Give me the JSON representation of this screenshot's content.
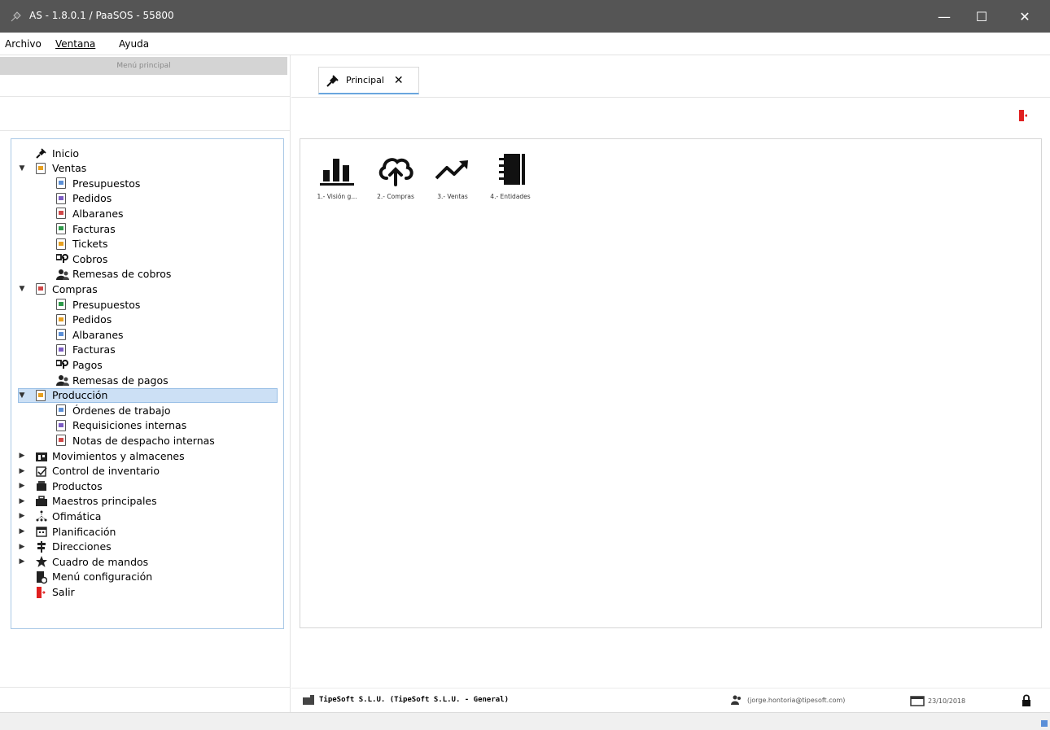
{
  "window": {
    "title": "AS - 1.8.0.1 / PaaSOS - 55800",
    "controls": {
      "minimize": "—",
      "maximize": "☐",
      "close": "✕"
    }
  },
  "menu": [
    "Archivo",
    "Ventana",
    "Ayuda"
  ],
  "left_header": "Menú principal",
  "tree": {
    "selected": "Producción",
    "items": [
      {
        "label": "Inicio",
        "level": 1,
        "expanded": null,
        "icon": "pin-icon"
      },
      {
        "label": "Ventas",
        "level": 1,
        "expanded": true,
        "icon": "document-icon"
      },
      {
        "label": "Presupuestos",
        "level": 2,
        "icon": "document-icon"
      },
      {
        "label": "Pedidos",
        "level": 2,
        "icon": "document-icon"
      },
      {
        "label": "Albaranes",
        "level": 2,
        "icon": "document-icon"
      },
      {
        "label": "Facturas",
        "level": 2,
        "icon": "document-icon"
      },
      {
        "label": "Tickets",
        "level": 2,
        "icon": "document-icon"
      },
      {
        "label": "Cobros",
        "level": 2,
        "icon": "payment-icon"
      },
      {
        "label": "Remesas de cobros",
        "level": 2,
        "icon": "people-icon"
      },
      {
        "label": "Compras",
        "level": 1,
        "expanded": true,
        "icon": "document-icon"
      },
      {
        "label": "Presupuestos",
        "level": 2,
        "icon": "document-icon"
      },
      {
        "label": "Pedidos",
        "level": 2,
        "icon": "document-icon"
      },
      {
        "label": "Albaranes",
        "level": 2,
        "icon": "document-icon"
      },
      {
        "label": "Facturas",
        "level": 2,
        "icon": "document-icon"
      },
      {
        "label": "Pagos",
        "level": 2,
        "icon": "payment-icon"
      },
      {
        "label": "Remesas de pagos",
        "level": 2,
        "icon": "people-icon"
      },
      {
        "label": "Producción",
        "level": 1,
        "expanded": true,
        "icon": "document-icon"
      },
      {
        "label": "Órdenes de trabajo",
        "level": 2,
        "icon": "document-icon"
      },
      {
        "label": "Requisiciones internas",
        "level": 2,
        "icon": "document-icon"
      },
      {
        "label": "Notas de despacho internas",
        "level": 2,
        "icon": "document-icon"
      },
      {
        "label": "Movimientos y almacenes",
        "level": 1,
        "expanded": false,
        "icon": "warehouse-icon"
      },
      {
        "label": "Control de inventario",
        "level": 1,
        "expanded": false,
        "icon": "checklist-icon"
      },
      {
        "label": "Productos",
        "level": 1,
        "expanded": false,
        "icon": "box-icon"
      },
      {
        "label": "Maestros principales",
        "level": 1,
        "expanded": false,
        "icon": "briefcase-icon"
      },
      {
        "label": "Ofimática",
        "level": 1,
        "expanded": false,
        "icon": "network-icon"
      },
      {
        "label": "Planificación",
        "level": 1,
        "expanded": false,
        "icon": "calendar-icon"
      },
      {
        "label": "Direcciones",
        "level": 1,
        "expanded": false,
        "icon": "signpost-icon"
      },
      {
        "label": "Cuadro de mandos",
        "level": 1,
        "expanded": false,
        "icon": "star-icon"
      },
      {
        "label": "Menú configuración",
        "level": 1,
        "expanded": null,
        "icon": "settings-icon"
      },
      {
        "label": "Salir",
        "level": 1,
        "expanded": null,
        "icon": "exit-icon"
      }
    ]
  },
  "tabs": [
    {
      "label": "Principal",
      "active": true
    }
  ],
  "tiles": [
    {
      "label": "1.- Visión g...",
      "icon": "bar-chart-icon"
    },
    {
      "label": "2.- Compras",
      "icon": "cloud-upload-icon"
    },
    {
      "label": "3.- Ventas",
      "icon": "trend-up-icon"
    },
    {
      "label": "4.- Entidades",
      "icon": "contacts-book-icon"
    }
  ],
  "status": {
    "company": "TipeSoft S.L.U. (TipeSoft S.L.U. - General)",
    "user": "(jorge.hontoria@tipesoft.com)",
    "date": "23/10/2018"
  },
  "colors": {
    "titlebar": "#555555",
    "selection": "#cce0f5",
    "tree_border": "#a9c8e6",
    "tab_underline": "#6aa6de",
    "exit_red": "#e02020"
  }
}
